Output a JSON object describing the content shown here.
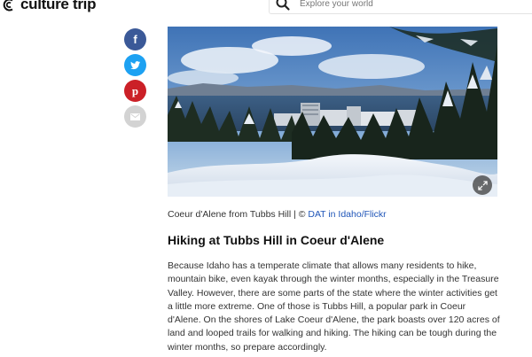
{
  "header": {
    "logo_text": "culture trip",
    "search": {
      "placeholder": "Explore your world",
      "value": ""
    }
  },
  "share": {
    "buttons": [
      {
        "network": "facebook",
        "icon": "facebook-icon",
        "color": "#3b5998",
        "glyph": "f"
      },
      {
        "network": "twitter",
        "icon": "twitter-icon",
        "color": "#1da1f2"
      },
      {
        "network": "pinterest",
        "icon": "pinterest-icon",
        "color": "#cb2027",
        "glyph": "p"
      },
      {
        "network": "email",
        "icon": "email-icon",
        "color": "#d3d3d3"
      }
    ]
  },
  "article": {
    "image": {
      "expand_icon": "expand-icon"
    },
    "caption": {
      "text": "Coeur d'Alene from Tubbs Hill | © ",
      "credit_link": "DAT in Idaho/Flickr"
    },
    "section_title": "Hiking at Tubbs Hill in Coeur d'Alene",
    "paragraph": "Because Idaho has a temperate climate that allows many residents to hike, mountain bike, even kayak through the winter months, especially in the Treasure Valley. However, there are some parts of the state where the winter activities get a little more extreme. One of those is Tubbs Hill, a popular park in Coeur d'Alene. On the shores of Lake Coeur d'Alene, the park boasts over 120 acres of land and looped trails for walking and hiking. The hiking can be tough during the winter months, so prepare accordingly."
  },
  "colors": {
    "link": "#1f55b8",
    "text": "#333333",
    "title": "#111111"
  }
}
